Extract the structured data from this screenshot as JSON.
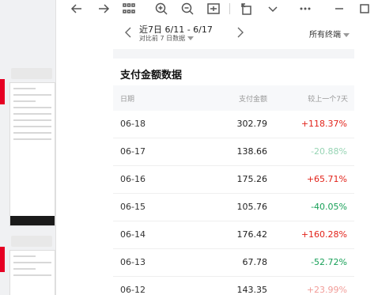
{
  "toolbar": {
    "icons": [
      "back-icon",
      "forward-icon",
      "grid-icon",
      "zoom-in-icon",
      "zoom-out-icon",
      "fit-width-icon",
      "rotate-icon",
      "chevron-down-icon",
      "more-icon",
      "minimize-icon",
      "maximize-icon"
    ]
  },
  "date_picker": {
    "range_label": "近7日 6/11 - 6/17",
    "compare_label": "对比前 7 日数据"
  },
  "terminal_filter": {
    "label": "所有终端"
  },
  "section": {
    "title": "支付金额数据"
  },
  "table": {
    "headers": [
      "日期",
      "支付金额",
      "较上一个7天"
    ],
    "rows": [
      {
        "date": "06-18",
        "amount": "302.79",
        "change": "+118.37%",
        "trend": "up"
      },
      {
        "date": "06-17",
        "amount": "138.66",
        "change": "-20.88%",
        "trend": "down"
      },
      {
        "date": "06-16",
        "amount": "175.26",
        "change": "+65.71%",
        "trend": "up"
      },
      {
        "date": "06-15",
        "amount": "105.76",
        "change": "-40.05%",
        "trend": "down"
      },
      {
        "date": "06-14",
        "amount": "176.42",
        "change": "+160.28%",
        "trend": "up"
      },
      {
        "date": "06-13",
        "amount": "67.78",
        "change": "-52.72%",
        "trend": "down"
      },
      {
        "date": "06-12",
        "amount": "143.35",
        "change": "+23.99%",
        "trend": "up"
      }
    ]
  },
  "colors": {
    "up": "#e2231a",
    "down": "#18a058",
    "accent": "#e60023"
  }
}
